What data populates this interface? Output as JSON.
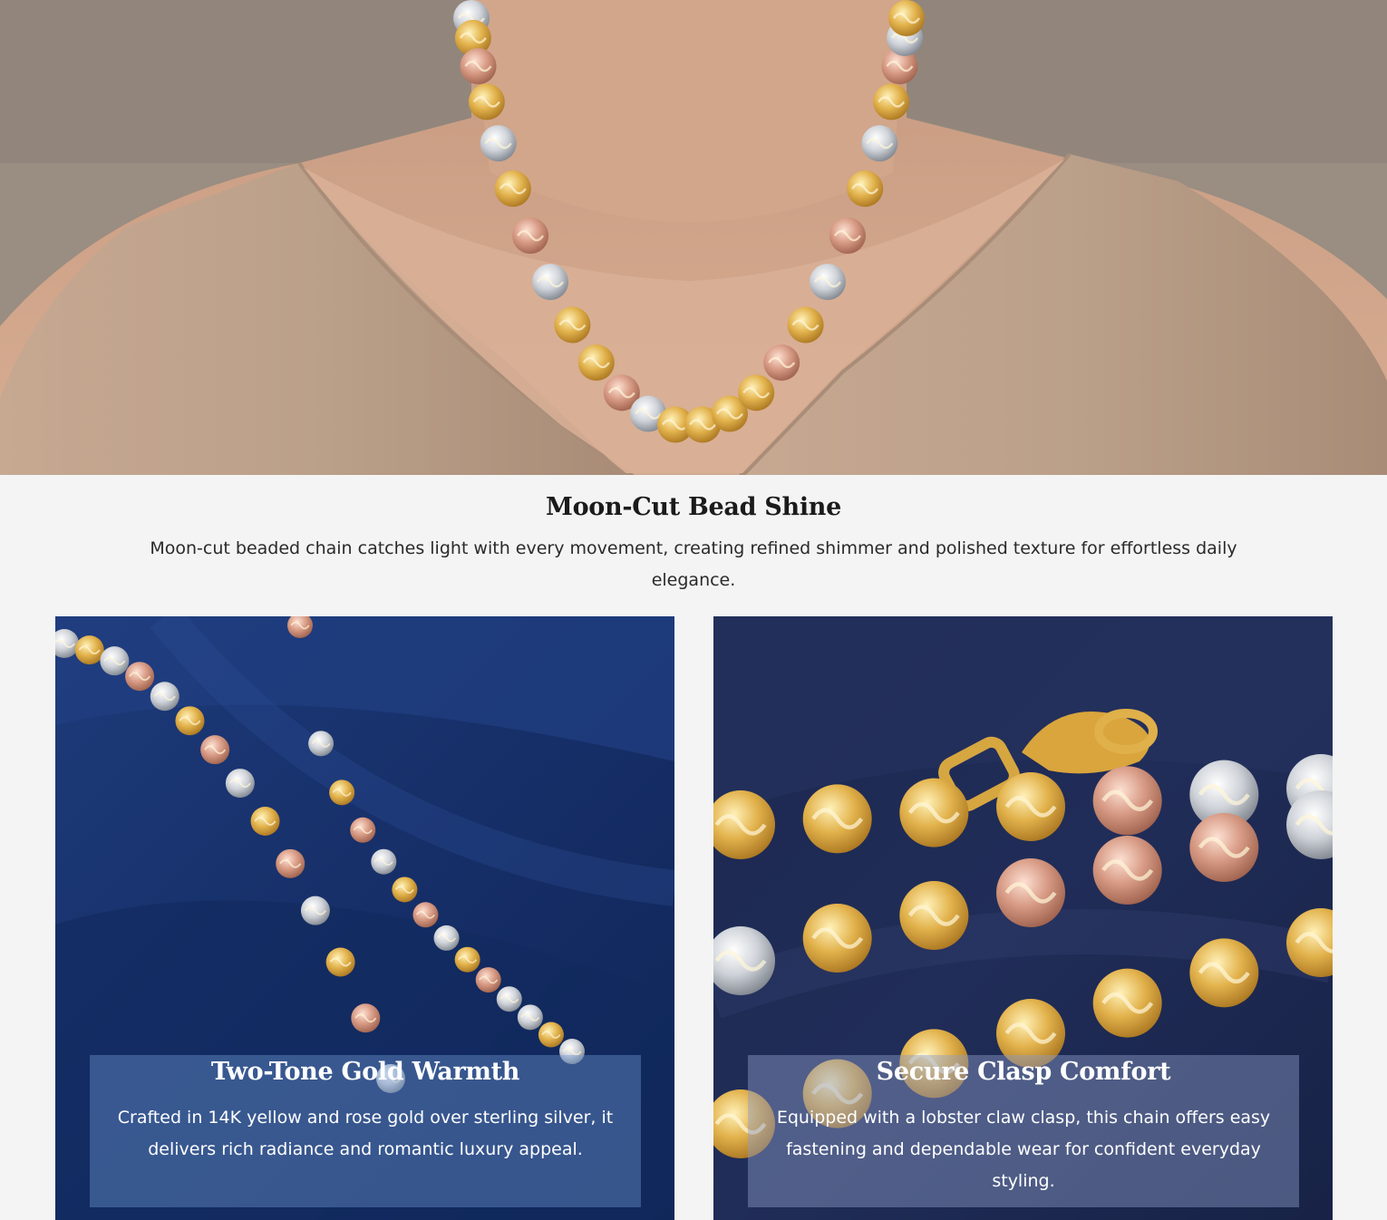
{
  "hero": {
    "image_alt": "Model wearing a moon-cut bead necklace in yellow, rose and white tones"
  },
  "intro": {
    "title": "Moon-Cut Bead Shine",
    "description": "Moon-cut beaded chain catches light with every movement, creating refined shimmer and polished texture for effortless daily elegance."
  },
  "cards": [
    {
      "title": "Two-Tone Gold Warmth",
      "description": "Crafted in 14K yellow and rose gold over sterling silver, it delivers rich radiance and romantic luxury appeal."
    },
    {
      "title": "Secure Clasp Comfort",
      "description": "Equipped with a lobster claw clasp, this chain offers easy fastening and dependable wear for confident everyday styling."
    }
  ],
  "colors": {
    "page_bg": "#f4f4f4",
    "gold": "#e0b04a",
    "rose": "#d79a84",
    "silver": "#d9dde3",
    "navy": "#17306a"
  }
}
